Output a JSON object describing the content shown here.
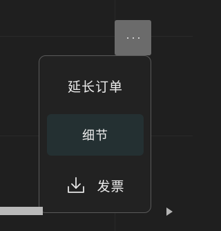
{
  "header": {
    "more_button_icon": "ellipsis-horizontal-icon"
  },
  "menu": {
    "items": [
      {
        "label": "延长订单"
      },
      {
        "label": "细节",
        "highlighted": true
      },
      {
        "label": "发票",
        "icon": "download-icon"
      }
    ]
  },
  "colors": {
    "background": "#1f1f1f",
    "menu_background": "#222222",
    "menu_border": "#5a5a5a",
    "highlight": "#243032",
    "more_button": "#6b6b6b",
    "text": "#ececec"
  }
}
